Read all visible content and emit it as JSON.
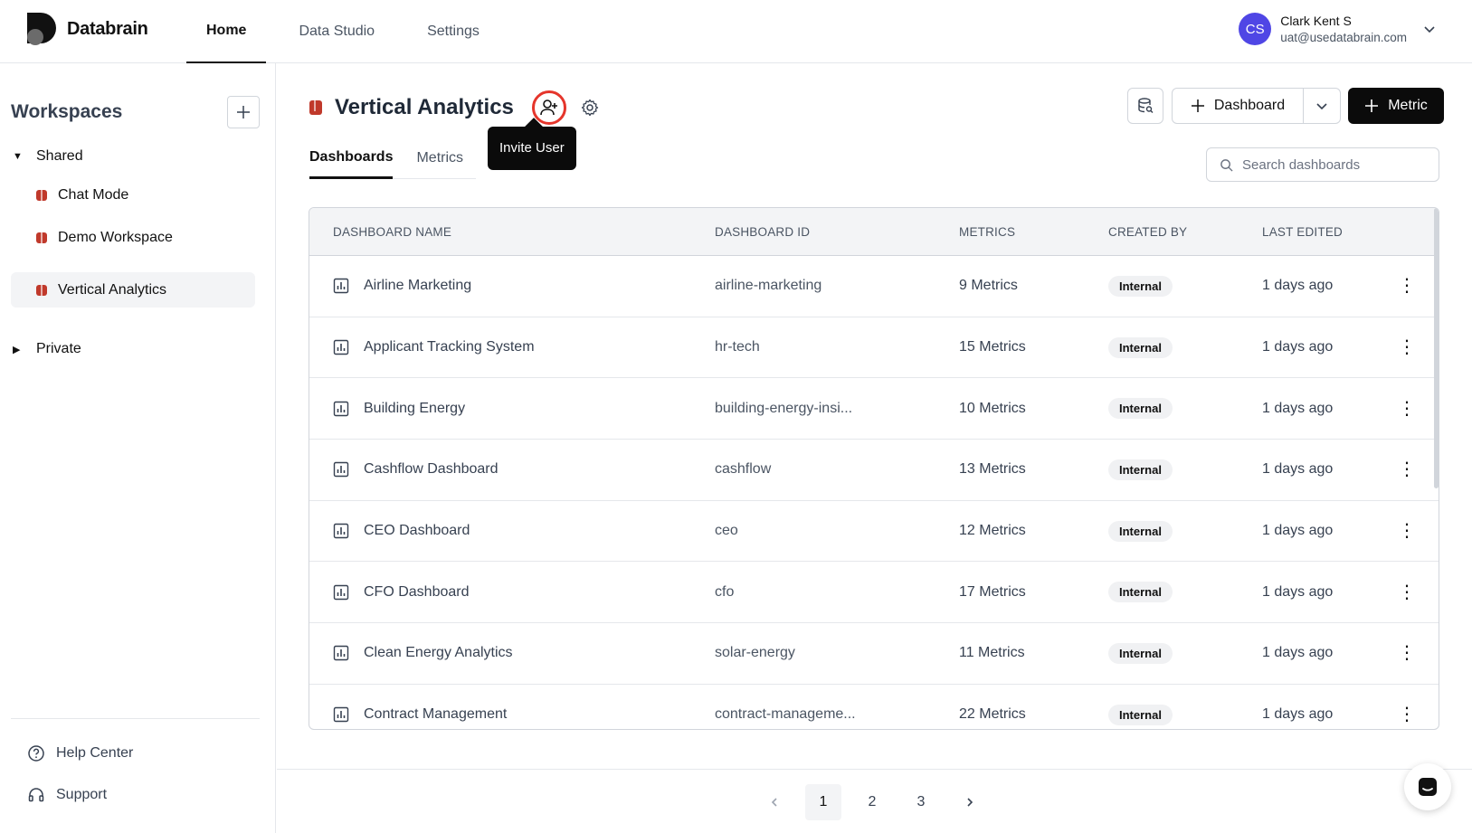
{
  "app": {
    "name": "Databrain"
  },
  "nav": [
    {
      "label": "Home",
      "active": true
    },
    {
      "label": "Data Studio",
      "active": false
    },
    {
      "label": "Settings",
      "active": false
    }
  ],
  "user": {
    "initials": "CS",
    "name": "Clark Kent S",
    "email": "uat@usedatabrain.com"
  },
  "sidebar": {
    "title": "Workspaces",
    "groups": [
      {
        "label": "Shared",
        "expanded": true
      },
      {
        "label": "Private",
        "expanded": false
      }
    ],
    "items": [
      {
        "label": "Chat Mode",
        "active": false
      },
      {
        "label": "Demo Workspace",
        "active": false
      },
      {
        "label": "Vertical Analytics",
        "active": true
      }
    ],
    "footer": [
      {
        "label": "Help Center",
        "icon": "help-circle-icon"
      },
      {
        "label": "Support",
        "icon": "headset-icon"
      }
    ]
  },
  "workspace": {
    "title": "Vertical Analytics"
  },
  "tooltip": {
    "text": "Invite User"
  },
  "actions": {
    "dashboard_label": "Dashboard",
    "metric_label": "Metric"
  },
  "tabs": [
    {
      "label": "Dashboards",
      "active": true
    },
    {
      "label": "Metrics",
      "active": false
    }
  ],
  "search": {
    "placeholder": "Search dashboards",
    "value": ""
  },
  "table": {
    "columns": [
      "DASHBOARD NAME",
      "DASHBOARD ID",
      "METRICS",
      "CREATED BY",
      "LAST EDITED"
    ],
    "rows": [
      {
        "name": "Airline Marketing",
        "id": "airline-marketing",
        "metrics": "9 Metrics",
        "created_by": "Internal",
        "last_edited": "1 days ago"
      },
      {
        "name": "Applicant Tracking System",
        "id": "hr-tech",
        "metrics": "15 Metrics",
        "created_by": "Internal",
        "last_edited": "1 days ago"
      },
      {
        "name": "Building Energy",
        "id": "building-energy-insi...",
        "metrics": "10 Metrics",
        "created_by": "Internal",
        "last_edited": "1 days ago"
      },
      {
        "name": "Cashflow Dashboard",
        "id": "cashflow",
        "metrics": "13 Metrics",
        "created_by": "Internal",
        "last_edited": "1 days ago"
      },
      {
        "name": "CEO Dashboard",
        "id": "ceo",
        "metrics": "12 Metrics",
        "created_by": "Internal",
        "last_edited": "1 days ago"
      },
      {
        "name": "CFO Dashboard",
        "id": "cfo",
        "metrics": "17 Metrics",
        "created_by": "Internal",
        "last_edited": "1 days ago"
      },
      {
        "name": "Clean Energy Analytics",
        "id": "solar-energy",
        "metrics": "11 Metrics",
        "created_by": "Internal",
        "last_edited": "1 days ago"
      },
      {
        "name": "Contract Management",
        "id": "contract-manageme...",
        "metrics": "22 Metrics",
        "created_by": "Internal",
        "last_edited": "1 days ago"
      }
    ]
  },
  "pagination": {
    "pages": [
      "1",
      "2",
      "3"
    ],
    "current": "1"
  },
  "colors": {
    "brand_dark": "#0b0b0b",
    "avatar": "#4f46e5",
    "workspace_icon": "#c0392b",
    "highlight_ring": "#e5352b"
  }
}
